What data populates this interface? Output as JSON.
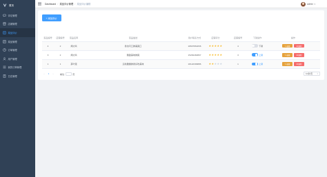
{
  "app": {
    "logo_text": "首页"
  },
  "sidebar": {
    "items": [
      {
        "label": "评论管理",
        "icon": "comment-icon",
        "active": false
      },
      {
        "label": "店铺管理",
        "icon": "shop-icon",
        "active": false
      },
      {
        "label": "菜品评价",
        "icon": "dish-icon",
        "active": true
      },
      {
        "label": "菜品管理",
        "icon": "menu-icon",
        "active": false
      },
      {
        "label": "订单管理",
        "icon": "order-icon",
        "active": false
      },
      {
        "label": "用户管理",
        "icon": "user-icon",
        "active": false
      },
      {
        "label": "我的订单管理",
        "icon": "list-icon",
        "active": false
      },
      {
        "label": "日志管理",
        "icon": "log-icon",
        "active": false
      }
    ]
  },
  "header": {
    "breadcrumbs": [
      "Dashboard",
      "菜品评价管理",
      "菜品评价编辑"
    ],
    "user_name": "admin"
  },
  "toolbar": {
    "add_label": "+ 添加评价"
  },
  "table": {
    "columns": [
      "菜品编号",
      "店铺编号",
      "菜品名称",
      "菜品描述",
      "用户联系方式",
      "店铺评分",
      "店铺编号",
      "下架操作",
      "操作"
    ],
    "rows": [
      {
        "c1": "4",
        "c2": "2",
        "c3": "烤大鸡",
        "c4": "香浓可口鲜美爽口",
        "c5": "18607861836",
        "rating": 5,
        "c7": "4",
        "on": false,
        "status": "下架"
      },
      {
        "c1": "3",
        "c2": "2",
        "c3": "烤大鸡",
        "c4": "酸甜美味鲜爽",
        "c5": "15284460867",
        "rating": 5,
        "c7": "3",
        "on": true,
        "status": "上架"
      },
      {
        "c1": "1",
        "c2": "1",
        "c3": "茶叶蛋",
        "c4": "清新脆嫩鲜香好吃美味",
        "c5": "18122309886",
        "rating": 2,
        "c7": "1",
        "on": true,
        "status": "上架"
      }
    ],
    "edit_label": "✎ 编辑",
    "delete_label": "✖ 删除"
  },
  "pagination": {
    "current_page": "1",
    "goto_prefix": "前往",
    "goto_suffix": "页",
    "page_size": "10条/页"
  },
  "colors": {
    "sidebar_bg": "#304156",
    "primary": "#409eff",
    "warning": "#e6a23c",
    "danger": "#f56c6c",
    "star": "#f7ba2a"
  }
}
